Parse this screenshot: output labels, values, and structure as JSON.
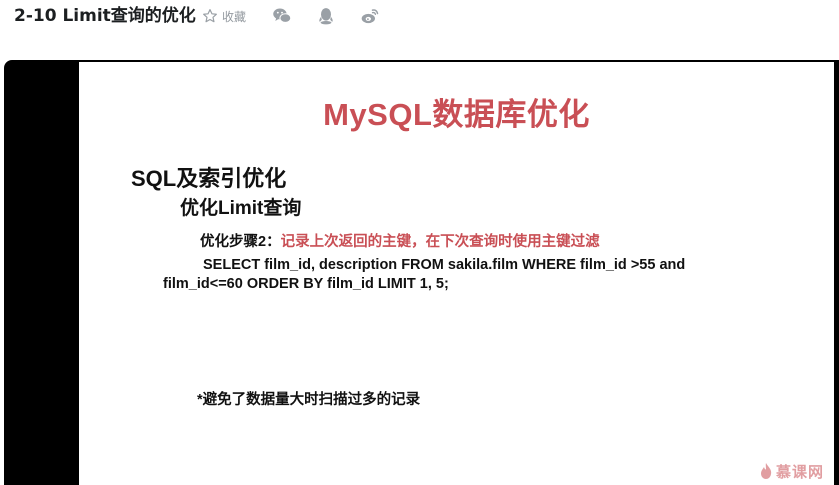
{
  "page": {
    "title": "2-10 Limit查询的优化",
    "favorite_label": "收藏"
  },
  "share_icons": [
    "wechat-icon",
    "qq-icon",
    "weibo-icon"
  ],
  "slide": {
    "title": "MySQL数据库优化",
    "heading1": "SQL及索引优化",
    "heading2": "优化Limit查询",
    "step_label": "优化步骤2：",
    "step_desc": "记录上次返回的主键，在下次查询时使用主键过滤",
    "sql": "SELECT film_id, description FROM sakila.film WHERE film_id >55 and film_id<=60 ORDER BY film_id LIMIT 1, 5;",
    "note": "*避免了数据量大时扫描过多的记录"
  },
  "watermark": "慕课网",
  "colors": {
    "accent_red": "#c94f55",
    "icon_gray": "#9aa0a6",
    "player_bg": "#000000"
  }
}
